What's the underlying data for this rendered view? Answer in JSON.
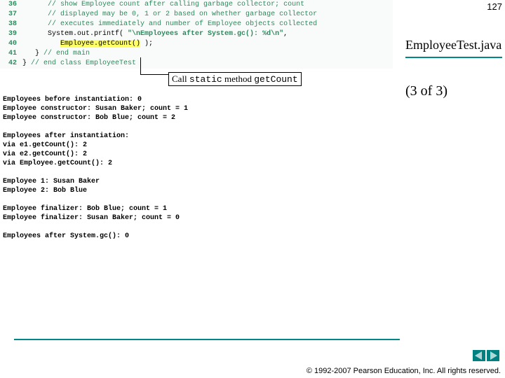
{
  "page_number": "127",
  "code": {
    "lines": [
      {
        "n": "36",
        "indent": "      ",
        "type": "comment",
        "text": "// show Employee count after calling garbage collector; count"
      },
      {
        "n": "37",
        "indent": "      ",
        "type": "comment",
        "text": "// displayed may be 0, 1 or 2 based on whether garbage collector"
      },
      {
        "n": "38",
        "indent": "      ",
        "type": "comment",
        "text": "// executes immediately and number of Employee objects collected"
      },
      {
        "n": "39",
        "indent": "      ",
        "type": "printf",
        "prefix": "System.out.printf( ",
        "str": "\"\\nEmployees after System.gc(): %d\\n\"",
        "suffix": ","
      },
      {
        "n": "40",
        "indent": "         ",
        "type": "hl",
        "hl": "Employee.getCount()",
        "suffix": " );"
      },
      {
        "n": "41",
        "indent": "   ",
        "type": "plain",
        "text": "} ",
        "comment": "// end main"
      },
      {
        "n": "42",
        "indent": "",
        "type": "plain",
        "text": "} ",
        "comment": "// end class EmployeeTest"
      }
    ]
  },
  "output": "Employees before instantiation: 0\nEmployee constructor: Susan Baker; count = 1\nEmployee constructor: Bob Blue; count = 2\n\nEmployees after instantiation:\nvia e1.getCount(): 2\nvia e2.getCount(): 2\nvia Employee.getCount(): 2\n\nEmployee 1: Susan Baker\nEmployee 2: Bob Blue\n\nEmployee finalizer: Bob Blue; count = 1\nEmployee finalizer: Susan Baker; count = 0\n\nEmployees after System.gc(): 0",
  "callout": {
    "pre": "Call ",
    "mono1": "static",
    "mid": " method ",
    "mono2": "getCount"
  },
  "side": {
    "title": "EmployeeTest.java",
    "sub": "(3 of  3)"
  },
  "copyright": "© 1992-2007 Pearson Education, Inc.  All rights reserved."
}
